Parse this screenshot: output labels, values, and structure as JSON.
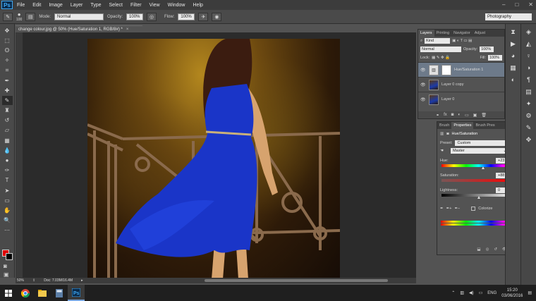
{
  "app": {
    "logo": "Ps",
    "menu": [
      "File",
      "Edit",
      "Image",
      "Layer",
      "Type",
      "Select",
      "Filter",
      "View",
      "Window",
      "Help"
    ],
    "window_controls": [
      "–",
      "□",
      "✕"
    ]
  },
  "options_bar": {
    "brush_size": "100",
    "mode_label": "Mode:",
    "mode_value": "Normal",
    "opacity_label": "Opacity:",
    "opacity_value": "100%",
    "flow_label": "Flow:",
    "flow_value": "100%",
    "workspace": "Photography"
  },
  "document": {
    "tab_title": "change colour.jpg @ 50% (Hue/Saturation 1, RGB/8#) *",
    "close": "×",
    "zoom": "50%",
    "doc_size": "Doc: 7.03M/16.4M"
  },
  "layers_panel": {
    "tabs": [
      "Layers",
      "Printing",
      "Navigator",
      "Adjust"
    ],
    "kind_label": "Kind",
    "blend_mode": "Normal",
    "opacity_label": "Opacity:",
    "opacity_value": "100%",
    "lock_label": "Lock:",
    "fill_label": "Fill:",
    "fill_value": "100%",
    "layers": [
      {
        "name": "Hue/Saturation 1",
        "selected": true
      },
      {
        "name": "Layer 0 copy",
        "selected": false
      },
      {
        "name": "Layer 0",
        "selected": false
      }
    ]
  },
  "properties_panel": {
    "tabs": [
      "Brush",
      "Properties",
      "Brush Pres"
    ],
    "title": "Hue/Saturation",
    "preset_label": "Preset:",
    "preset_value": "Custom",
    "channel_value": "Master",
    "hue_label": "Hue:",
    "hue_value": "+23",
    "hue_level": 0.56,
    "saturation_label": "Saturation:",
    "saturation_value": "+88",
    "saturation_level": 0.94,
    "lightness_label": "Lightness:",
    "lightness_value": "0",
    "lightness_level": 0.5,
    "colorize_label": "Colorize"
  },
  "taskbar": {
    "language": "ENG",
    "time": "15:20",
    "date": "03/06/2016"
  },
  "colors": {
    "foreground": "#e10000",
    "background": "#000000",
    "dress": "#1a35c8"
  }
}
